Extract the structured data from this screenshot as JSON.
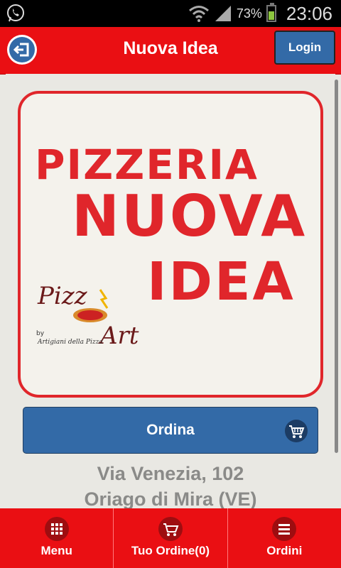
{
  "status": {
    "battery": "73%",
    "time": "23:06"
  },
  "header": {
    "title": "Nuova Idea",
    "login_label": "Login"
  },
  "logo": {
    "line1": "PIZZERIA",
    "line2": "NUOVA",
    "line3": "IDEA",
    "badge_top": "Pizz",
    "badge_bottom": "Art",
    "badge_by": "by",
    "badge_tagline": "Artigiani della Pizza"
  },
  "order": {
    "label": "Ordina"
  },
  "address": {
    "line1": "Via Venezia, 102",
    "line2": "Oriago di Mira (VE)"
  },
  "tabs": [
    {
      "label": "Menu",
      "icon": "grid-icon"
    },
    {
      "label": "Tuo Ordine(0)",
      "icon": "cart-icon"
    },
    {
      "label": "Ordini",
      "icon": "list-icon"
    }
  ],
  "colors": {
    "brand_red": "#ea0f13",
    "button_blue": "#336aa7",
    "logo_red": "#e0262b"
  }
}
